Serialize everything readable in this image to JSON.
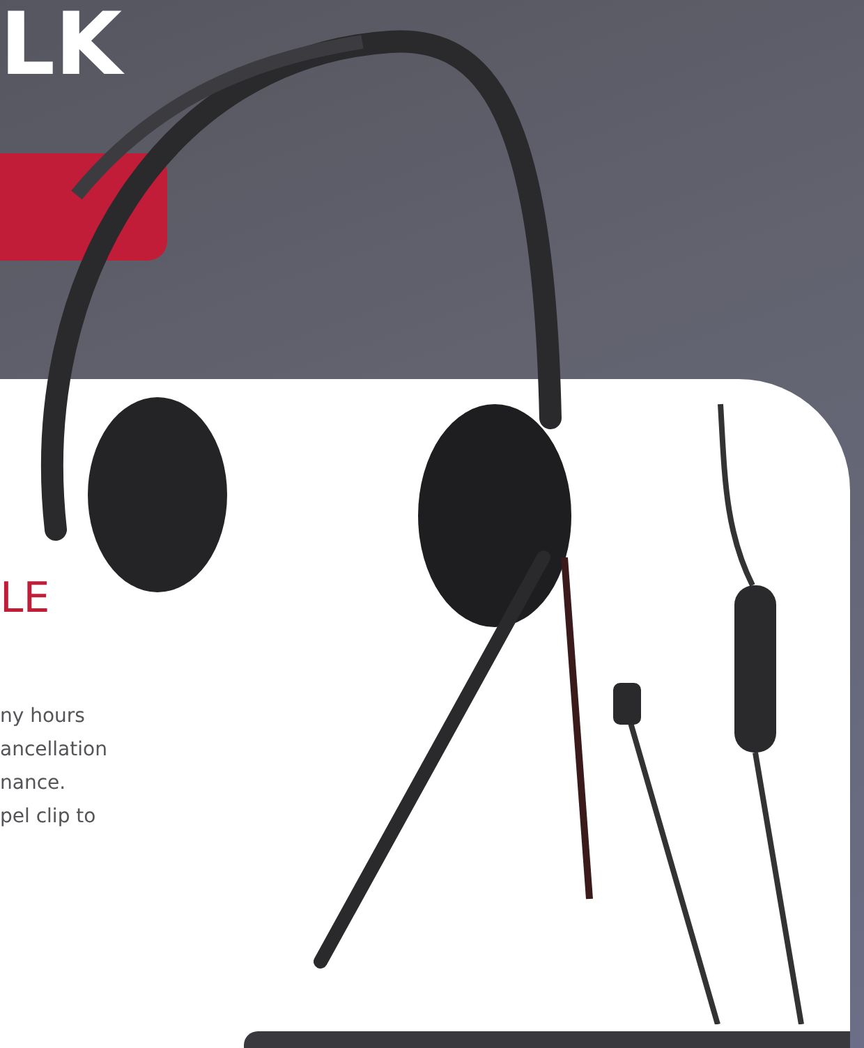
{
  "hero": {
    "title": "LK"
  },
  "section": {
    "heading": "LE",
    "paragraph": "ny hours\nancellation\nnance.\npel clip to"
  }
}
